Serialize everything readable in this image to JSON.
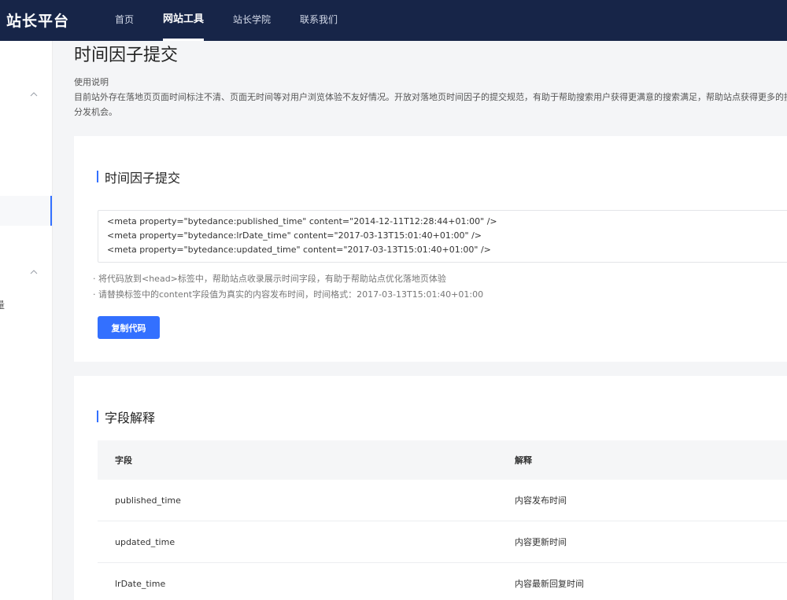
{
  "header": {
    "brand": "站长平台",
    "nav": [
      {
        "label": "首页",
        "active": false
      },
      {
        "label": "网站工具",
        "active": true
      },
      {
        "label": "站长学院",
        "active": false
      },
      {
        "label": "联系我们",
        "active": false
      }
    ]
  },
  "sidebar": {
    "partial_text": "量"
  },
  "page": {
    "title": "时间因子提交",
    "usage_label": "使用说明",
    "usage_desc": "目前站外存在落地页页面时间标注不清、页面无时间等对用户浏览体验不友好情况。开放对落地页时间因子的提交规范，有助于帮助搜索用户获得更满意的搜索满足，帮助站点获得更多的搜索分发机会。"
  },
  "submit_section": {
    "title": "时间因子提交",
    "code_lines": [
      "<meta property=\"bytedance:published_time\" content=\"2014-12-11T12:28:44+01:00\" />",
      "<meta property=\"bytedance:lrDate_time\" content=\"2017-03-13T15:01:40+01:00\" />",
      "<meta property=\"bytedance:updated_time\" content=\"2017-03-13T15:01:40+01:00\" />"
    ],
    "notes": [
      "· 将代码放到<head>标签中，帮助站点收录展示时间字段，有助于帮助站点优化落地页体验",
      "· 请替换标签中的content字段值为真实的内容发布时间，时间格式：2017-03-13T15:01:40+01:00"
    ],
    "copy_button": "复制代码"
  },
  "fields_section": {
    "title": "字段解释",
    "columns": [
      "字段",
      "解释"
    ],
    "rows": [
      {
        "field": "published_time",
        "desc": "内容发布时间"
      },
      {
        "field": "updated_time",
        "desc": "内容更新时间"
      },
      {
        "field": "lrDate_time",
        "desc": "内容最新回复时间"
      }
    ]
  }
}
